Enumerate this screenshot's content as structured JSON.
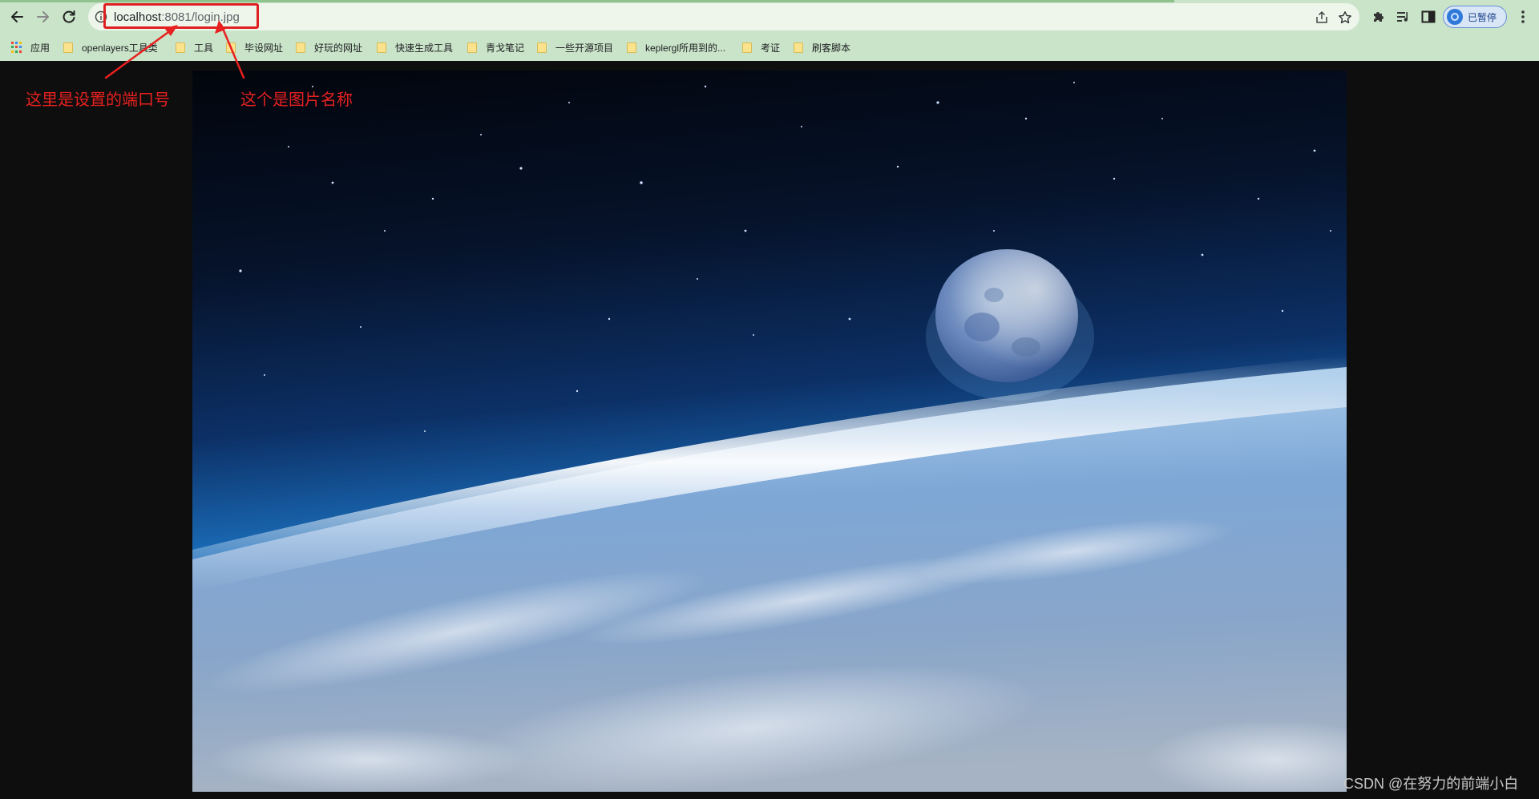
{
  "browser": {
    "url_host": "localhost",
    "url_rest": ":8081/login.jpg",
    "profile_status": "已暂停"
  },
  "bookmarks": [
    {
      "label": "应用",
      "kind": "apps"
    },
    {
      "label": "openlayers工具类",
      "kind": "folder"
    },
    {
      "label": "工具",
      "kind": "folder"
    },
    {
      "label": "毕设网址",
      "kind": "folder"
    },
    {
      "label": "好玩的网址",
      "kind": "folder"
    },
    {
      "label": "快速生成工具",
      "kind": "folder"
    },
    {
      "label": "青戈笔记",
      "kind": "folder"
    },
    {
      "label": "一些开源项目",
      "kind": "folder"
    },
    {
      "label": "keplergl所用到的...",
      "kind": "folder"
    },
    {
      "label": "考证",
      "kind": "folder"
    },
    {
      "label": "刷客脚本",
      "kind": "folder"
    }
  ],
  "annotations": {
    "port": "这里是设置的端口号",
    "image_name": "这个是图片名称"
  },
  "watermark": "CSDN @在努力的前端小白",
  "colors": {
    "toolbar": "#c9e4c8",
    "annotation": "#e82020",
    "page_background": "#0e0e0e"
  },
  "icons": {
    "back": "arrow-left",
    "forward": "arrow-right",
    "reload": "reload",
    "site_info": "info-circle",
    "share": "share",
    "bookmark_star": "star",
    "extensions": "puzzle",
    "media": "playlist",
    "side_panel": "side-panel",
    "menu": "vertical-dots"
  }
}
